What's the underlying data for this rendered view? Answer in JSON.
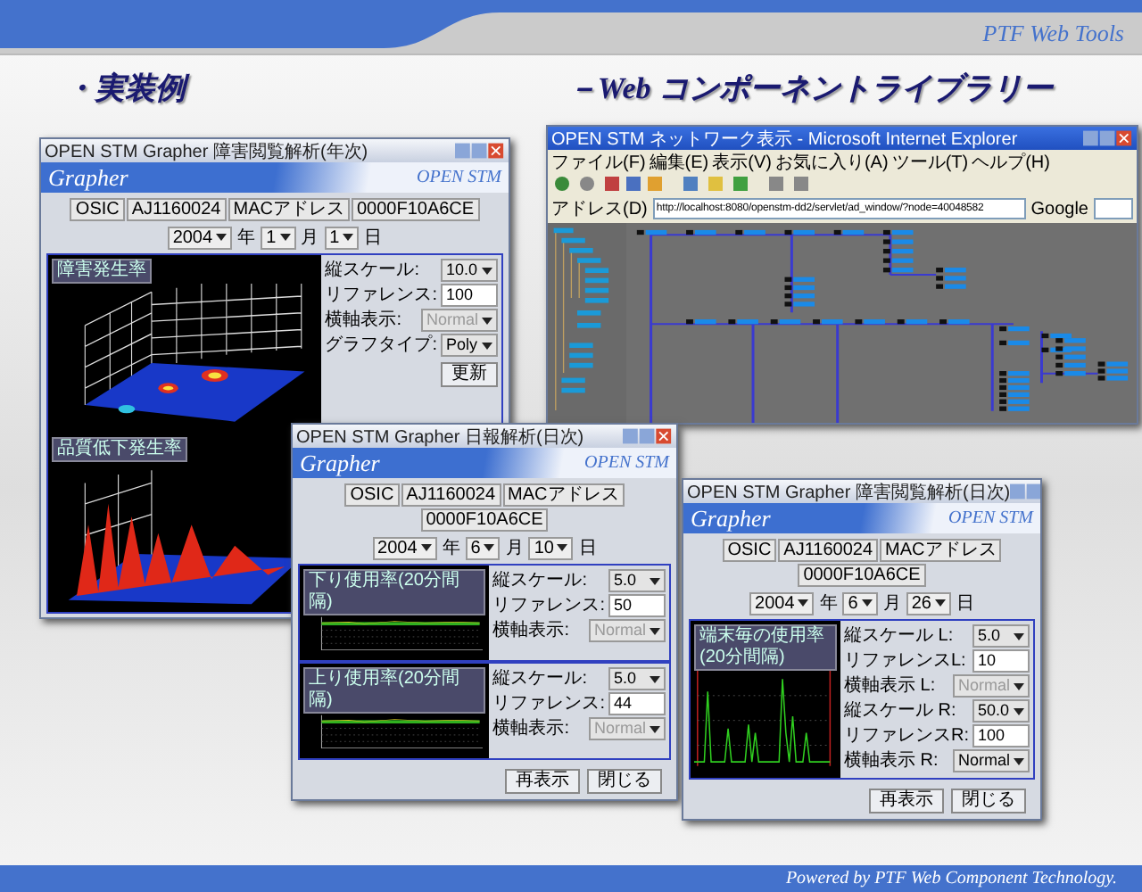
{
  "header": {
    "brand": "PTF Web Tools"
  },
  "slide": {
    "title": "・実装例",
    "subtitle": "－Web コンポーネントライブラリー"
  },
  "windows": [
    {
      "kind": "grapher",
      "title": "OPEN STM Grapher 障害閲覧解析(年次)",
      "brand": "Grapher",
      "product": "OPEN STM",
      "tags": [
        "OSIC",
        "AJ1160024",
        "MACアドレス",
        "0000F10A6CE"
      ],
      "date": {
        "year": "2004",
        "year_unit": "年",
        "month": "1",
        "month_unit": "月",
        "day": "1",
        "day_unit": "日"
      },
      "panels": [
        {
          "charts": [
            {
              "label": "障害発生率",
              "kind": "surface"
            },
            {
              "label": "品質低下発生率",
              "kind": "peaks"
            }
          ],
          "fields": [
            {
              "label": "縦スケール:",
              "value": "10.0",
              "kind": "select",
              "disabled": false
            },
            {
              "label": "リファレンス:",
              "value": "100",
              "kind": "input",
              "disabled": false
            },
            {
              "label": "横軸表示:",
              "value": "Normal",
              "kind": "select",
              "disabled": true
            },
            {
              "label": "グラフタイプ:",
              "value": "Poly",
              "kind": "select",
              "disabled": false
            }
          ],
          "button": "更新"
        }
      ]
    },
    {
      "kind": "browser",
      "title": "OPEN STM ネットワーク表示 - Microsoft Internet Explorer",
      "menu": [
        "ファイル(F)",
        "編集(E)",
        "表示(V)",
        "お気に入り(A)",
        "ツール(T)",
        "ヘルプ(H)"
      ],
      "address_label": "アドレス(D)",
      "url": "http://localhost:8080/openstm-dd2/servlet/ad_window/?node=40048582",
      "search_label": "Google"
    },
    {
      "kind": "grapher",
      "title": "OPEN STM Grapher 日報解析(日次)",
      "brand": "Grapher",
      "product": "OPEN STM",
      "tags": [
        "OSIC",
        "AJ1160024",
        "MACアドレス",
        "0000F10A6CE"
      ],
      "date": {
        "year": "2004",
        "year_unit": "年",
        "month": "6",
        "month_unit": "月",
        "day": "10",
        "day_unit": "日"
      },
      "panels": [
        {
          "charts": [
            {
              "label": "下り使用率(20分間隔)",
              "kind": "band"
            }
          ],
          "fields": [
            {
              "label": "縦スケール:",
              "value": "5.0",
              "kind": "select",
              "disabled": false
            },
            {
              "label": "リファレンス:",
              "value": "50",
              "kind": "input",
              "disabled": false
            },
            {
              "label": "横軸表示:",
              "value": "Normal",
              "kind": "select",
              "disabled": true
            }
          ]
        },
        {
          "charts": [
            {
              "label": "上り使用率(20分間隔)",
              "kind": "band"
            }
          ],
          "fields": [
            {
              "label": "縦スケール:",
              "value": "5.0",
              "kind": "select",
              "disabled": false
            },
            {
              "label": "リファレンス:",
              "value": "44",
              "kind": "input",
              "disabled": false
            },
            {
              "label": "横軸表示:",
              "value": "Normal",
              "kind": "select",
              "disabled": true
            }
          ]
        }
      ],
      "buttons": [
        "再表示",
        "閉じる"
      ]
    },
    {
      "kind": "grapher",
      "title": "OPEN STM Grapher 障害閲覧解析(日次)",
      "brand": "Grapher",
      "product": "OPEN STM",
      "tags": [
        "OSIC",
        "AJ1160024",
        "MACアドレス",
        "0000F10A6CE"
      ],
      "date": {
        "year": "2004",
        "year_unit": "年",
        "month": "6",
        "month_unit": "月",
        "day": "26",
        "day_unit": "日"
      },
      "panels": [
        {
          "charts": [
            {
              "label": "端末毎の使用率(20分間隔)",
              "kind": "spikes"
            }
          ],
          "fields": [
            {
              "label": "縦スケール L:",
              "value": "5.0",
              "kind": "select",
              "disabled": false
            },
            {
              "label": "リファレンスL:",
              "value": "10",
              "kind": "input",
              "disabled": false
            },
            {
              "label": "横軸表示 L:",
              "value": "Normal",
              "kind": "select",
              "disabled": true
            },
            {
              "label": "縦スケール R:",
              "value": "50.0",
              "kind": "select",
              "disabled": false
            },
            {
              "label": "リファレンスR:",
              "value": "100",
              "kind": "input",
              "disabled": false
            },
            {
              "label": "横軸表示 R:",
              "value": "Normal",
              "kind": "select",
              "disabled": false
            }
          ]
        }
      ],
      "buttons": [
        "再表示",
        "閉じる"
      ]
    }
  ],
  "footer": {
    "text": "Powered by PTF Web Component Technology."
  }
}
